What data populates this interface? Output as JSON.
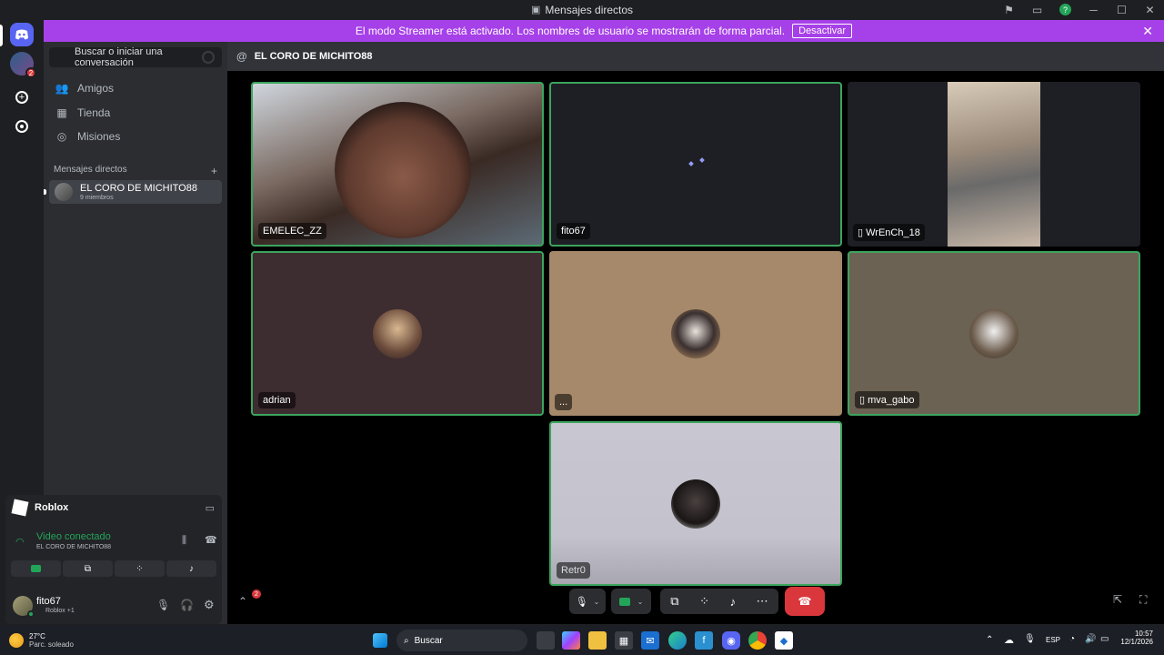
{
  "window": {
    "title": "Mensajes directos"
  },
  "banner": {
    "text": "El modo Streamer está activado. Los nombres de usuario se mostrarán de forma parcial.",
    "button": "Desactivar"
  },
  "guilds": {
    "badge": "2"
  },
  "sidebar": {
    "search_label": "Buscar o iniciar una conversación",
    "nav": [
      {
        "label": "Amigos"
      },
      {
        "label": "Tienda"
      },
      {
        "label": "Misiones"
      }
    ],
    "dm_header": "Mensajes directos",
    "dm_add": "+",
    "dm": {
      "name": "EL CORO DE MICHITO88",
      "members": "9 miembros"
    }
  },
  "voice": {
    "activity": "Roblox",
    "status": "Video conectado",
    "channel": "EL CORO DE MICHITO88",
    "user": {
      "name": "fito67",
      "sub": "Roblox +1"
    }
  },
  "channel": {
    "name": "EL CORO DE MICHITO88"
  },
  "tiles": [
    {
      "name": "EMELEC_ZZ"
    },
    {
      "name": "fito67"
    },
    {
      "name": "WrEnCh_18"
    },
    {
      "name": "adrian"
    },
    {
      "name": "..."
    },
    {
      "name": "mva_gabo"
    },
    {
      "name": "Retr0"
    }
  ],
  "controls": {
    "badge": "2"
  },
  "taskbar": {
    "weather_temp": "27°C",
    "weather_desc": "Parc. soleado",
    "search": "Buscar",
    "lang": "ESP",
    "time": "10:57",
    "date": "12/1/2026"
  },
  "colors": {
    "accent": "#a640e8",
    "speaking": "#3ba55d",
    "hangup": "#da373c",
    "discord": "#5865f2"
  }
}
